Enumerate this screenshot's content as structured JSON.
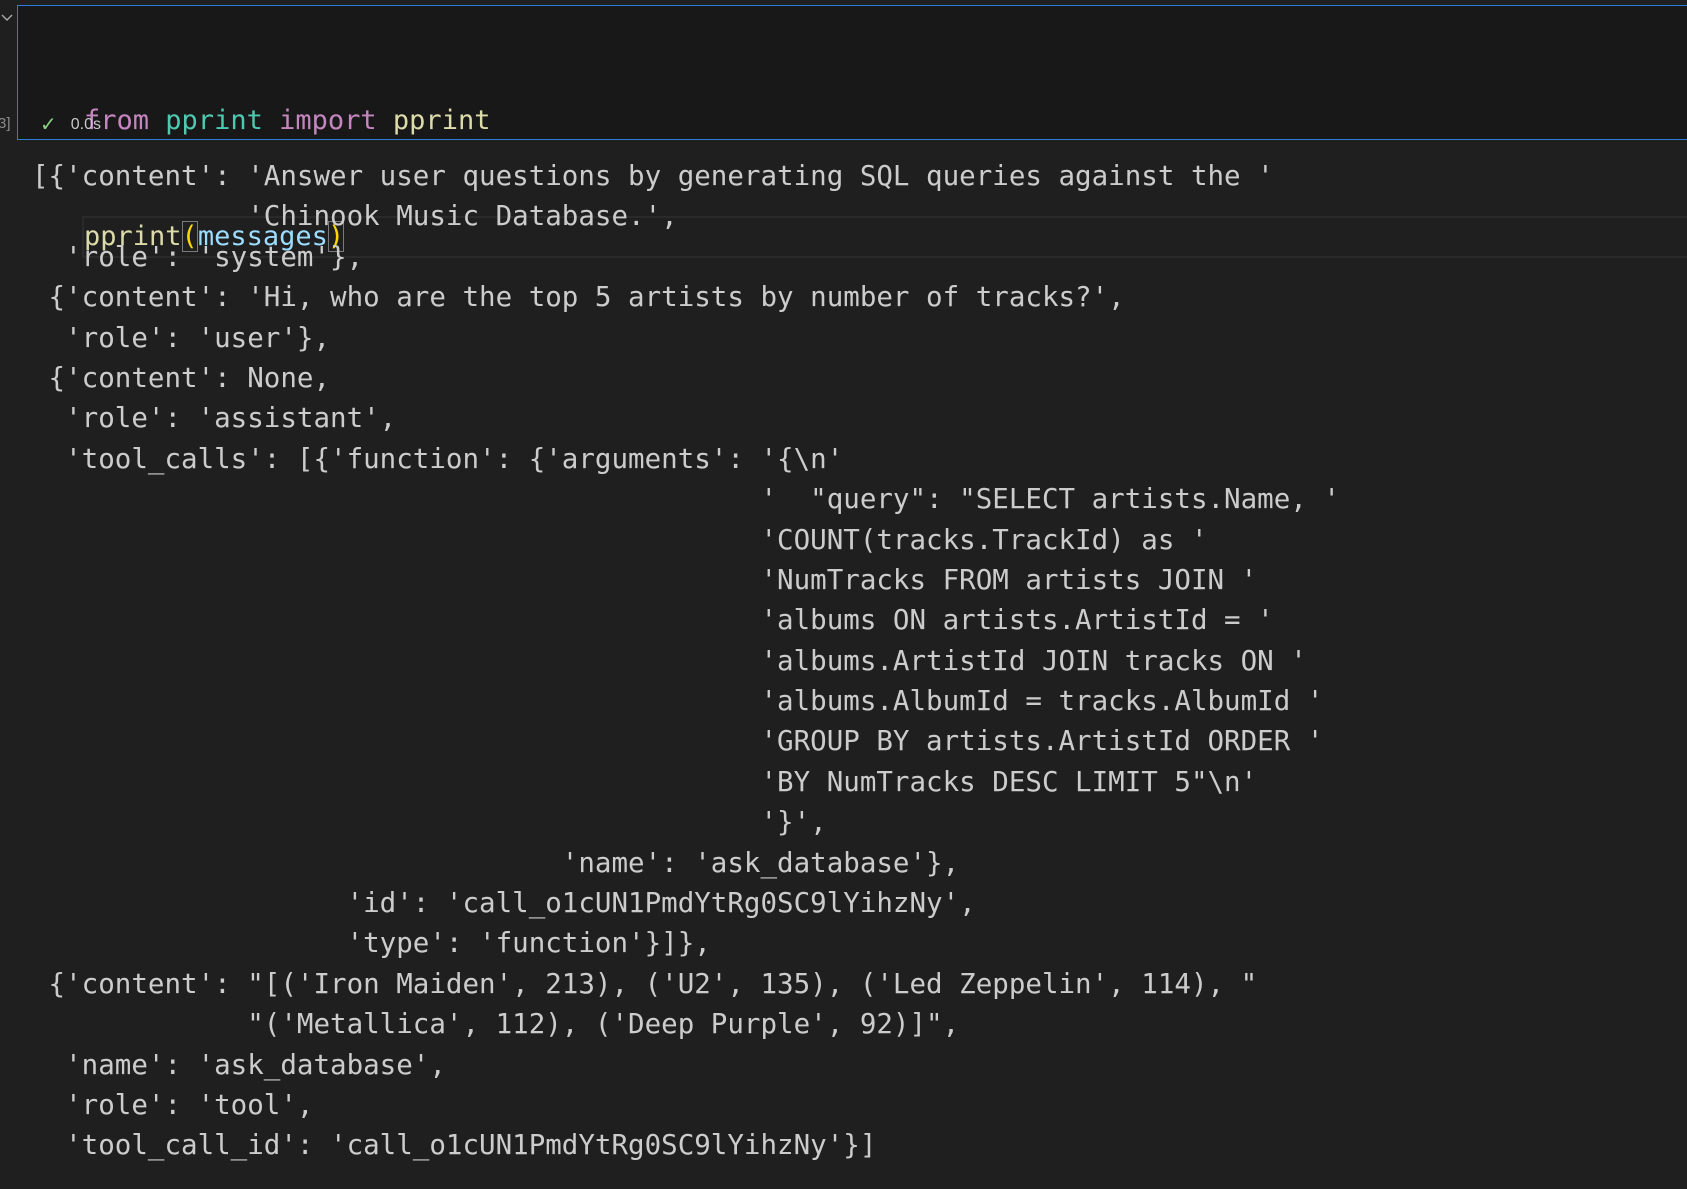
{
  "cell": {
    "execution_count": "3]",
    "code": {
      "line1": {
        "kw1": "from",
        "module": "pprint",
        "kw2": "import",
        "name": "pprint"
      },
      "line2": {
        "fn": "pprint",
        "open": "(",
        "arg": "messages",
        "close": ")"
      }
    },
    "status": {
      "icon": "check-icon",
      "duration": "0.0s"
    }
  },
  "colors": {
    "accent_border": "#2f7bd6",
    "success": "#89d185",
    "keyword": "#c586c0",
    "module": "#4ec9b0",
    "function": "#dcdcaa",
    "variable": "#9cdcfe",
    "bracket": "#ffd700"
  },
  "output": [
    "[{'content': 'Answer user questions by generating SQL queries against the '",
    "             'Chinook Music Database.',",
    "  'role': 'system'},",
    " {'content': 'Hi, who are the top 5 artists by number of tracks?',",
    "  'role': 'user'},",
    " {'content': None,",
    "  'role': 'assistant',",
    "  'tool_calls': [{'function': {'arguments': '{\\n'",
    "                                            '  \"query\": \"SELECT artists.Name, '",
    "                                            'COUNT(tracks.TrackId) as '",
    "                                            'NumTracks FROM artists JOIN '",
    "                                            'albums ON artists.ArtistId = '",
    "                                            'albums.ArtistId JOIN tracks ON '",
    "                                            'albums.AlbumId = tracks.AlbumId '",
    "                                            'GROUP BY artists.ArtistId ORDER '",
    "                                            'BY NumTracks DESC LIMIT 5\"\\n'",
    "                                            '}',",
    "                                'name': 'ask_database'},",
    "                   'id': 'call_o1cUN1PmdYtRg0SC9lYihzNy',",
    "                   'type': 'function'}]},",
    " {'content': \"[('Iron Maiden', 213), ('U2', 135), ('Led Zeppelin', 114), \"",
    "             \"('Metallica', 112), ('Deep Purple', 92)]\",",
    "  'name': 'ask_database',",
    "  'role': 'tool',",
    "  'tool_call_id': 'call_o1cUN1PmdYtRg0SC9lYihzNy'}]"
  ]
}
